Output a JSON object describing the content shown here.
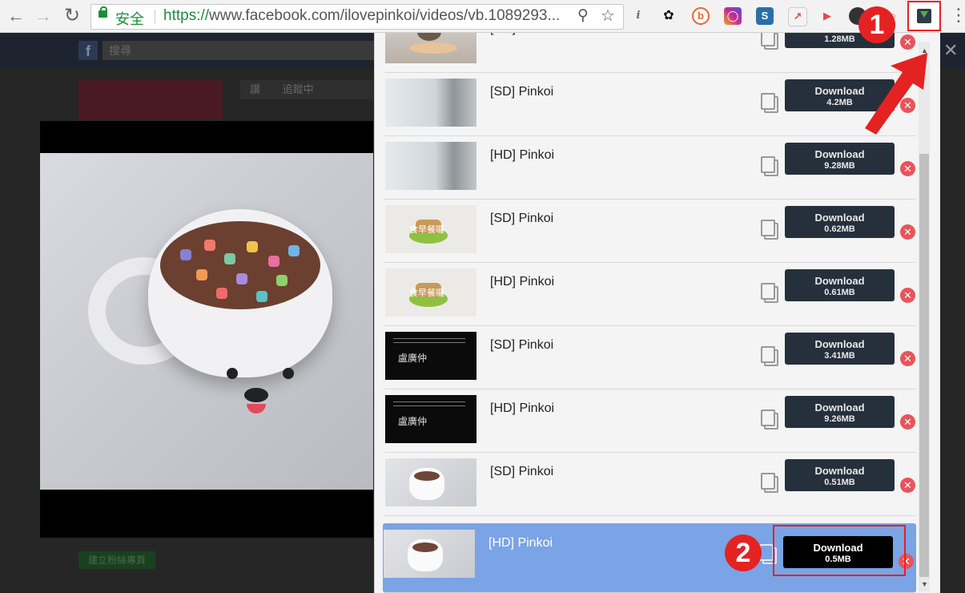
{
  "browser": {
    "secure_label": "安全",
    "url_scheme": "https://",
    "url_rest": "www.facebook.com/ilovepinkoi/videos/vb.1089293..."
  },
  "facebook": {
    "search_placeholder": "搜尋",
    "like_label": "讚",
    "follow_label": "追蹤中",
    "create_page_label": "建立粉絲專頁"
  },
  "popup": {
    "items": [
      {
        "title": "[HD] Pinkoi",
        "line1": "Download",
        "size": "1.28MB",
        "thumb": "cat"
      },
      {
        "title": "[SD] Pinkoi",
        "line1": "Download",
        "size": "4.2MB",
        "thumb": "light"
      },
      {
        "title": "[HD] Pinkoi",
        "line1": "Download",
        "size": "9.28MB",
        "thumb": "light"
      },
      {
        "title": "[SD] Pinkoi",
        "line1": "Download",
        "size": "0.62MB",
        "thumb": "cream"
      },
      {
        "title": "[HD] Pinkoi",
        "line1": "Download",
        "size": "0.61MB",
        "thumb": "cream"
      },
      {
        "title": "[SD] Pinkoi",
        "line1": "Download",
        "size": "3.41MB",
        "thumb": "black"
      },
      {
        "title": "[HD] Pinkoi",
        "line1": "Download",
        "size": "9.26MB",
        "thumb": "black"
      },
      {
        "title": "[SD] Pinkoi",
        "line1": "Download",
        "size": "0.51MB",
        "thumb": "cup"
      },
      {
        "title": "[HD] Pinkoi",
        "line1": "Download",
        "size": "0.5MB",
        "thumb": "cup",
        "selected": true
      }
    ],
    "thumb_text": {
      "cream": "食早餐囉",
      "black": "盧廣仲"
    }
  },
  "annotations": {
    "step1": "1",
    "step2": "2"
  },
  "colors": {
    "accent_red": "#e52222",
    "selected_row": "#7aa4e5",
    "button_dark": "#25303c"
  }
}
